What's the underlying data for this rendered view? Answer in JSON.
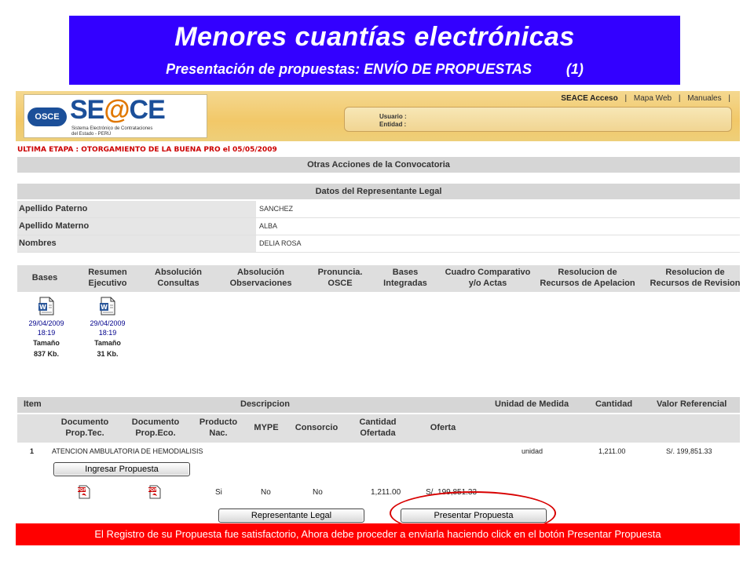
{
  "slide": {
    "title": "Menores cuantías electrónicas",
    "subtitle": "Presentación de propuestas: ENVÍO DE PROPUESTAS",
    "subtitle_tag": "(1)"
  },
  "seace": {
    "logo_badge": "OSCE",
    "logo_text_a": "SE",
    "logo_text_at": "@",
    "logo_text_b": "CE",
    "logo_line1": "Sistema Electrónico de Contrataciones",
    "logo_line2": "del Estado - PERÚ",
    "menu": [
      "SEACE Acceso",
      "|",
      "Mapa Web",
      "|",
      "Manuales",
      "|"
    ],
    "usuario_label": "Usuario :",
    "entidad_label": "Entidad :"
  },
  "etapa": "ULTIMA ETAPA : OTORGAMIENTO DE LA BUENA PRO el 05/05/2009",
  "sections": {
    "otras_acciones": "Otras Acciones de la Convocatoria",
    "datos_representante": "Datos del Representante Legal"
  },
  "representante": [
    {
      "label": "Apellido Paterno",
      "value": "SANCHEZ"
    },
    {
      "label": "Apellido Materno",
      "value": "ALBA"
    },
    {
      "label": "Nombres",
      "value": "DELIA ROSA"
    }
  ],
  "docs_headers": [
    [
      "Bases",
      ""
    ],
    [
      "Resumen",
      "Ejecutivo"
    ],
    [
      "Absolución",
      "Consultas"
    ],
    [
      "Absolución",
      "Observaciones"
    ],
    [
      "Pronuncia.",
      "OSCE"
    ],
    [
      "Bases",
      "Integradas"
    ],
    [
      "Cuadro Comparativo",
      "y/o Actas"
    ],
    [
      "Resolucion de",
      "Recursos de Apelacion"
    ],
    [
      "Resolucion de",
      "Recursos de Revision"
    ]
  ],
  "documents": [
    {
      "date": "29/04/2009",
      "time": "18:19",
      "size_label": "Tamaño",
      "size": "837 Kb.",
      "icon": "word-doc-icon"
    },
    {
      "date": "29/04/2009",
      "time": "18:19",
      "size_label": "Tamaño",
      "size": "31 Kb.",
      "icon": "word-doc-icon"
    }
  ],
  "items_header": {
    "item": "Item",
    "descripcion": "Descripcion",
    "unidad": "Unidad de Medida",
    "cantidad": "Cantidad",
    "valor": "Valor Referencial"
  },
  "items_subheader": [
    [
      "Documento",
      "Prop.Tec."
    ],
    [
      "Documento",
      "Prop.Eco."
    ],
    [
      "Producto",
      "Nac."
    ],
    [
      "MYPE",
      ""
    ],
    [
      "Consorcio",
      ""
    ],
    [
      "Cantidad",
      "Ofertada"
    ],
    [
      "Oferta",
      ""
    ]
  ],
  "item_row": {
    "num": "1",
    "descripcion": "ATENCION AMBULATORIA DE HEMODIALISIS",
    "unidad": "unidad",
    "cantidad": "1,211.00",
    "valor": "S/. 199,851.33"
  },
  "proposal_row": {
    "producto_nac": "Si",
    "mype": "No",
    "consorcio": "No",
    "cantidad_ofertada": "1,211.00",
    "oferta": "S/. 199,851.33"
  },
  "buttons": {
    "ingresar": "Ingresar Propuesta",
    "representante": "Representante Legal",
    "presentar": "Presentar Propuesta"
  },
  "status_message": "El Registro de su Propuesta fue satisfactorio, Ahora debe proceder a enviarla haciendo click en el botón Presentar Propuesta",
  "colors": {
    "title_bg": "#3300ff",
    "status_bg": "#ff0000",
    "highlight_circle": "#d80000",
    "etapa_text": "#cc0000"
  }
}
